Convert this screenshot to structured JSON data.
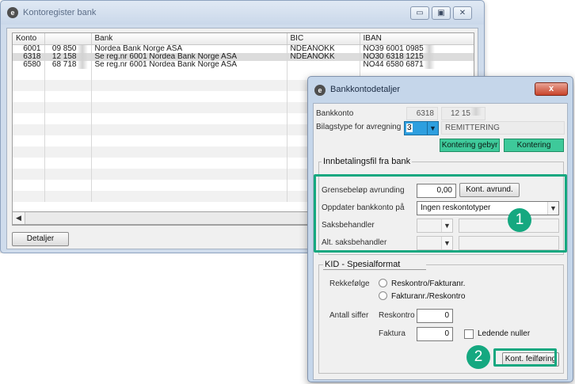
{
  "bank_register": {
    "title": "Kontoregister bank",
    "columns": [
      "Konto",
      "",
      "Bank",
      "BIC",
      "IBAN"
    ],
    "rows": [
      {
        "konto": "6001",
        "account": "09 850",
        "bank": "Nordea Bank Norge ASA",
        "bic": "NDEANOKK",
        "iban": "NO39 6001 0985"
      },
      {
        "konto": "6318",
        "account": "12 158",
        "bank": "Se reg.nr 6001 Nordea Bank Norge ASA",
        "bic": "NDEANOKK",
        "iban": "NO30 6318 1215"
      },
      {
        "konto": "6580",
        "account": "68 718",
        "bank": "Se reg.nr 6001 Nordea Bank Norge ASA",
        "bic": "",
        "iban": "NO44 6580 6871"
      }
    ],
    "details_button": "Detaljer"
  },
  "bank_details": {
    "title": "Bankkontodetaljer",
    "close_label": "x",
    "bankkonto_label": "Bankkonto",
    "bankkonto_value": "6318",
    "bankkonto_account": "12 15",
    "bilagstype_label": "Bilagstype for avregning",
    "bilagstype_value": "3",
    "bilagstype_desc": "REMITTERING",
    "kontering_gebyr_button": "Kontering gebyr",
    "kontering_button": "Kontering",
    "innbetaling": {
      "title": "Innbetalingsfil fra bank",
      "grensebelop_label": "Grensebeløp avrunding",
      "grensebelop_value": "0,00",
      "kont_avrund_button": "Kont. avrund.",
      "oppdater_label": "Oppdater bankkonto på",
      "oppdater_value": "Ingen reskontotyper",
      "saksbehandler_label": "Saksbehandler",
      "alt_saksbehandler_label": "Alt. saksbehandler"
    },
    "kid": {
      "title": "KID - Spesialformat",
      "rekkefolge_label": "Rekkefølge",
      "option1": "Reskontro/Fakturanr.",
      "option2": "Fakturanr./Reskontro",
      "antall_siffer_label": "Antall siffer",
      "reskontro_label": "Reskontro",
      "reskontro_value": "0",
      "faktura_label": "Faktura",
      "faktura_value": "0",
      "ledende_nuller_label": "Ledende nuller"
    },
    "kont_feilforing_button": "Kont. feilføring"
  },
  "callouts": [
    "1",
    "2"
  ],
  "colors": {
    "highlight": "#15a880",
    "green_button": "#3ec99a",
    "close_red": "#c8432a"
  },
  "icons": [
    "app-logo-icon",
    "minimize-icon",
    "maximize-icon",
    "close-icon",
    "chevron-down-icon",
    "scroll-left-icon"
  ]
}
